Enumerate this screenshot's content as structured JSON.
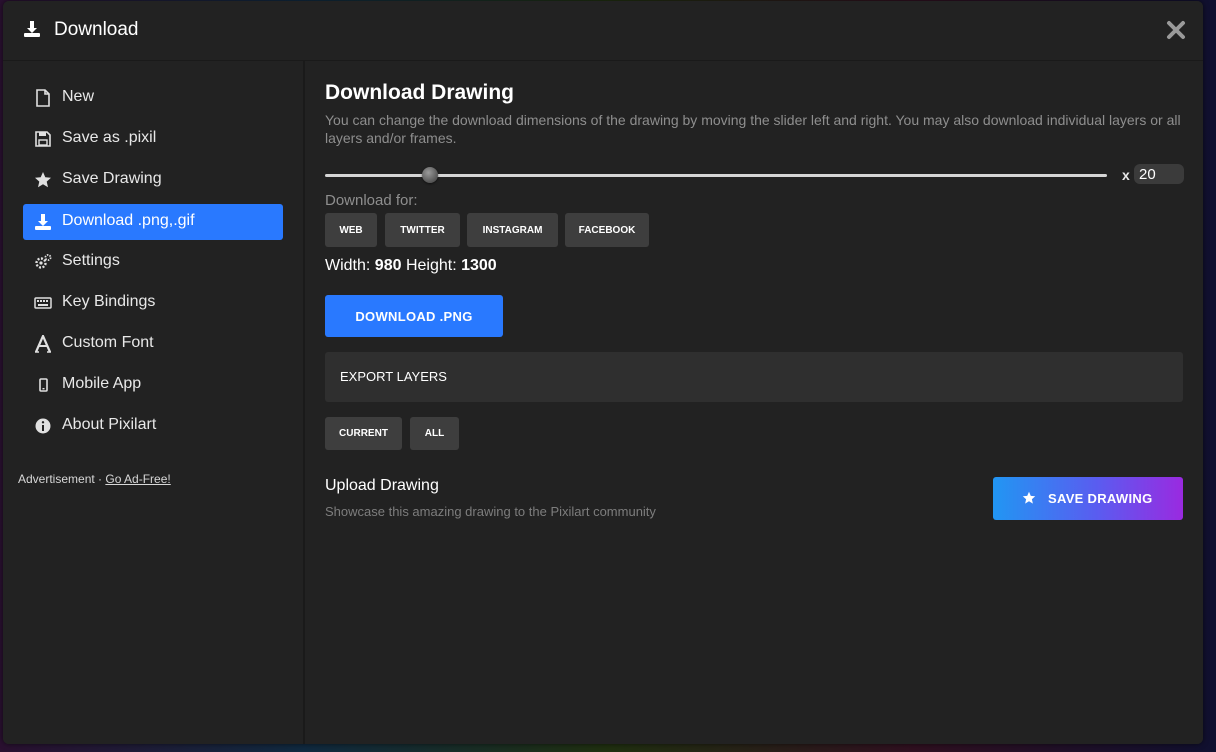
{
  "dialog": {
    "title": "Download",
    "icons": {
      "title": "download-icon",
      "close": "close-icon"
    }
  },
  "sidebar": {
    "items": [
      {
        "label": "New",
        "icon": "file-icon",
        "active": false
      },
      {
        "label": "Save as .pixil",
        "icon": "floppy-icon",
        "active": false
      },
      {
        "label": "Save Drawing",
        "icon": "star-icon",
        "active": false
      },
      {
        "label": "Download .png,.gif",
        "icon": "download-icon",
        "active": true
      },
      {
        "label": "Settings",
        "icon": "gears-icon",
        "active": false
      },
      {
        "label": "Key Bindings",
        "icon": "keyboard-icon",
        "active": false
      },
      {
        "label": "Custom Font",
        "icon": "font-icon",
        "active": false
      },
      {
        "label": "Mobile App",
        "icon": "mobile-icon",
        "active": false
      },
      {
        "label": "About Pixilart",
        "icon": "info-icon",
        "active": false
      }
    ],
    "ad_text": "Advertisement · ",
    "ad_link": "Go Ad-Free!"
  },
  "main": {
    "title": "Download Drawing",
    "description": "You can change the download dimensions of the drawing by moving the slider left and right. You may also download individual layers or all layers and/or frames.",
    "scale_prefix": "x",
    "scale_value": "20",
    "scale_slider_fraction": 0.134,
    "download_for_label": "Download for:",
    "presets": [
      "WEB",
      "TWITTER",
      "INSTAGRAM",
      "FACEBOOK"
    ],
    "width_label": "Width:",
    "width_value": "980",
    "height_label": "Height:",
    "height_value": "1300",
    "download_png_label": "DOWNLOAD .PNG",
    "export_layers_label": "EXPORT LAYERS",
    "layer_buttons": [
      "CURRENT",
      "ALL"
    ],
    "upload_title": "Upload Drawing",
    "upload_desc": "Showcase this amazing drawing to the Pixilart community",
    "save_drawing_label": "SAVE DRAWING"
  },
  "colors": {
    "accent": "#2979ff",
    "background": "#222222",
    "button": "#3e3e3e"
  }
}
